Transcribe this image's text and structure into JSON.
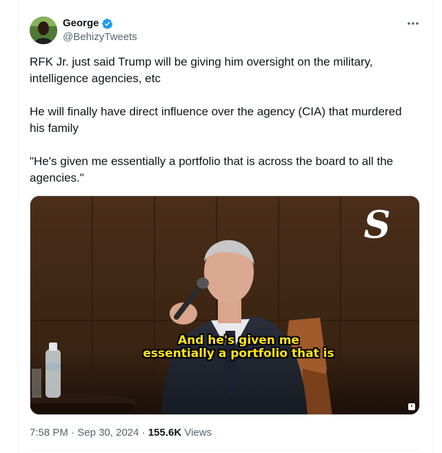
{
  "author": {
    "display_name": "George",
    "handle": "@BehizyTweets",
    "verified": true
  },
  "tweet": {
    "paragraphs": [
      "RFK Jr. just said Trump will be giving him oversight on the military, intelligence agencies, etc",
      "He will finally have direct influence over the agency (CIA) that murdered his family",
      "\"He's given me essentially a portfolio that is across the board to all the agencies.\""
    ]
  },
  "media": {
    "caption_line1": "And he's given me",
    "caption_line2": "essentially a portfolio that is",
    "watermark_letter": "S"
  },
  "meta": {
    "time": "7:58 PM",
    "separator1": " · ",
    "date": "Sep 30, 2024",
    "separator2": " · ",
    "views_count": "155.6K",
    "views_label": " Views"
  },
  "colors": {
    "verified_blue": "#1d9bf0",
    "caption_yellow": "#ffe419",
    "secondary_text": "#536471"
  }
}
